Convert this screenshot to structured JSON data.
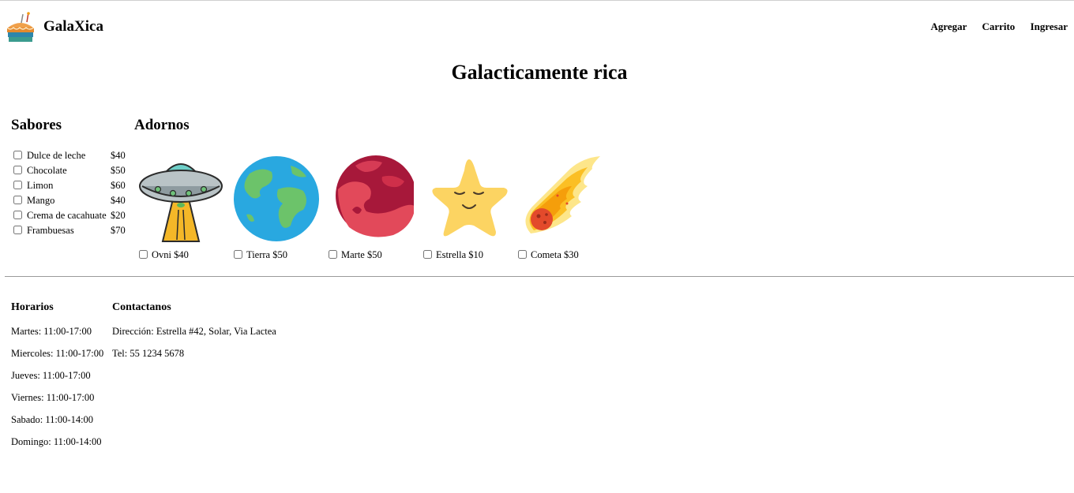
{
  "header": {
    "brand": "GalaXica",
    "logo_icon": "cake-icon"
  },
  "nav": {
    "agregar": "Agregar",
    "carrito": "Carrito",
    "ingresar": "Ingresar"
  },
  "title": "Galacticamente rica",
  "sabores": {
    "heading": "Sabores",
    "items": [
      {
        "name": "Dulce de leche",
        "price": "$40"
      },
      {
        "name": "Chocolate",
        "price": "$50"
      },
      {
        "name": "Limon",
        "price": "$60"
      },
      {
        "name": "Mango",
        "price": "$40"
      },
      {
        "name": "Crema de cacahuate",
        "price": "$20"
      },
      {
        "name": "Frambuesas",
        "price": "$70"
      }
    ]
  },
  "adornos": {
    "heading": "Adornos",
    "items": [
      {
        "label": "Ovni $40",
        "icon": "ufo-icon"
      },
      {
        "label": "Tierra $50",
        "icon": "earth-icon"
      },
      {
        "label": "Marte $50",
        "icon": "mars-icon"
      },
      {
        "label": "Estrella $10",
        "icon": "star-icon"
      },
      {
        "label": "Cometa $30",
        "icon": "comet-icon"
      }
    ]
  },
  "horarios": {
    "heading": "Horarios",
    "lines": [
      "Martes: 11:00-17:00",
      "Miercoles: 11:00-17:00",
      "Jueves: 11:00-17:00",
      "Viernes: 11:00-17:00",
      "Sabado: 11:00-14:00",
      "Domingo: 11:00-14:00"
    ]
  },
  "contacto": {
    "heading": "Contactanos",
    "direccion": "Dirección: Estrella #42, Solar, Via Lactea",
    "tel": "Tel: 55 1234 5678"
  }
}
